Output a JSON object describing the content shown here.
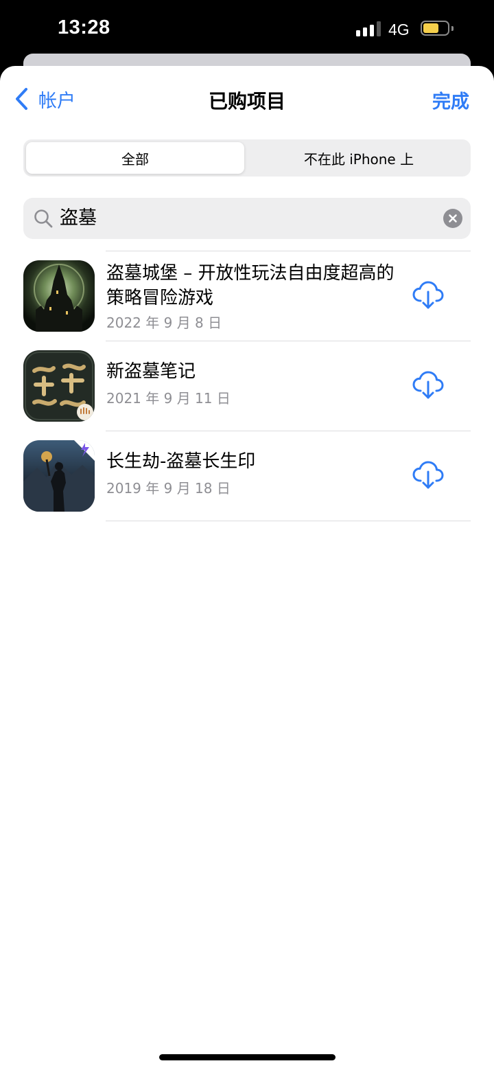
{
  "status_bar": {
    "time": "13:28",
    "network": "4G",
    "battery_level": 0.65,
    "battery_color": "#f5cf4b",
    "signal_bars_active": 3,
    "signal_bars_total": 4
  },
  "nav": {
    "back_label": "帐户",
    "title": "已购项目",
    "done_label": "完成",
    "accent_color": "#2f7cf6"
  },
  "segments": {
    "items": [
      "全部",
      "不在此 iPhone 上"
    ],
    "selected": "全部"
  },
  "search": {
    "query": "盗墓",
    "search_icon": "magnifying-glass-icon",
    "clear_icon": "clear-circle-icon"
  },
  "apps": [
    {
      "name": "盗墓城堡 – 开放性玩法自由度超高的策略冒险游戏",
      "date": "2022 年 9 月 8 日",
      "action_icon": "cloud-download-icon"
    },
    {
      "name": "新盗墓笔记",
      "date": "2021 年 9 月 11 日",
      "action_icon": "cloud-download-icon"
    },
    {
      "name": "长生劫-盗墓长生印",
      "date": "2019 年 9 月 18 日",
      "action_icon": "cloud-download-icon"
    }
  ]
}
